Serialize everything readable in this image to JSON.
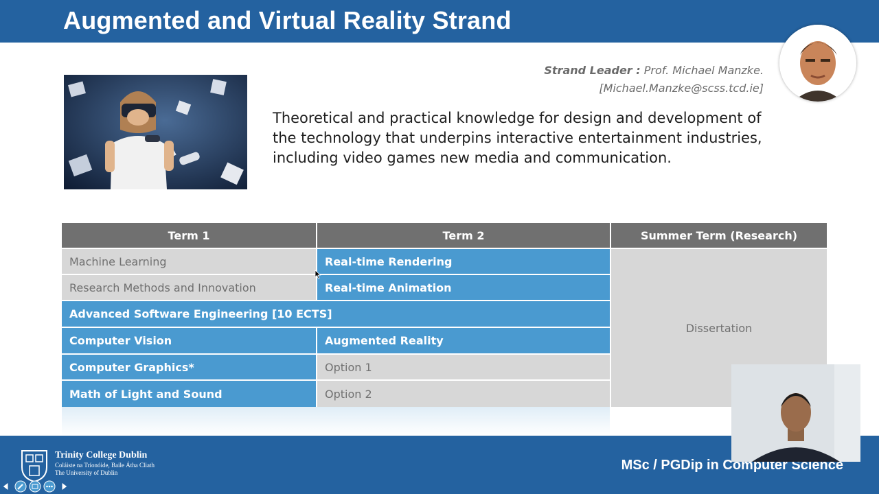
{
  "slide": {
    "title": "Augmented and Virtual Reality Strand",
    "leader_label": "Strand Leader :",
    "leader_name": " Prof. Michael Manzke.",
    "leader_email": "[Michael.Manzke@scss.tcd.ie]",
    "description": "Theoretical and practical knowledge for design and development of the technology that underpins interactive entertainment industries, including video games new media and communication.",
    "table": {
      "headers": [
        "Term 1",
        "Term 2",
        "Summer Term (Research)"
      ],
      "term1": [
        "Machine Learning",
        "Research Methods and Innovation",
        "Advanced Software Engineering [10 ECTS]",
        "Computer Vision",
        "Computer Graphics*",
        "Math of Light and Sound"
      ],
      "term2": [
        "Real-time Rendering",
        "Real-time Animation",
        "Augmented Reality",
        "Option 1",
        "Option 2"
      ],
      "summer": "Dissertation"
    },
    "footer": {
      "college_name": "Trinity College Dublin",
      "college_irish": "Coláiste na Tríonóide, Baile Átha Cliath",
      "college_sub": "The University of Dublin",
      "programme": "MSc / PGDip in Computer Science"
    }
  },
  "icons": [
    "vr-photo",
    "leader-avatar",
    "college-crest",
    "webcam-feed",
    "prev-slide-icon",
    "pen-icon",
    "slides-icon",
    "more-icon",
    "next-slide-icon",
    "mouse-cursor-icon"
  ],
  "colors": {
    "header_blue": "#2462a0",
    "table_blue": "#4a9ad0",
    "table_grey": "#d7d7d7",
    "header_grey": "#707070"
  }
}
